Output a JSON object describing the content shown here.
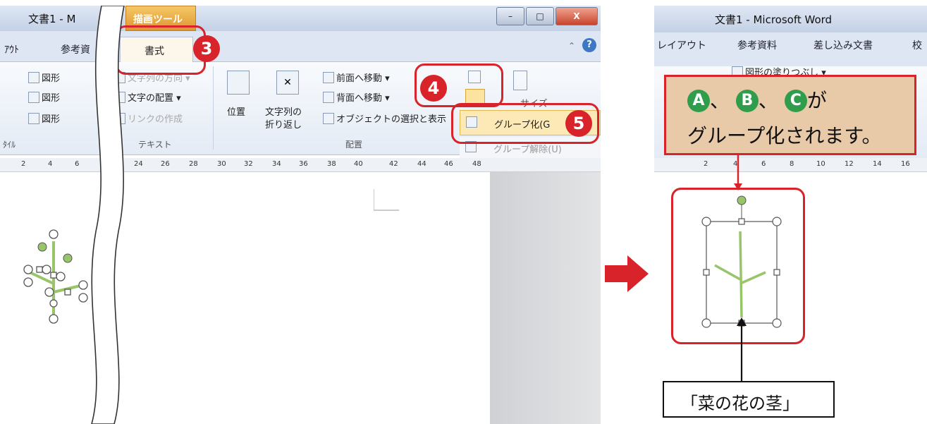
{
  "left": {
    "title": "文書1 - M",
    "tool_tab": "描画ツール",
    "window_controls": [
      "–",
      "□",
      "X"
    ],
    "tabs": [
      "ｱｳﾄ",
      "参考資"
    ],
    "active_tab": "書式",
    "help_icon": "?",
    "ribbon": {
      "shape_fill": "図形",
      "shape_outline": "図形",
      "shape_effects": "図形",
      "text_direction": "文字列の方向",
      "text_align": "文字の配置",
      "create_link": "リンクの作成",
      "text_group": "テキスト",
      "style_group": "ﾀｲﾙ",
      "position": "位置",
      "wrap_text_1": "文字列の",
      "wrap_text_2": "折り返し",
      "bring_forward": "前面へ移動",
      "send_backward": "背面へ移動",
      "selection_pane": "オブジェクトの選択と表示",
      "arrange_group": "配置",
      "size": "サイズ"
    },
    "menu": {
      "group": "グループ化(G",
      "ungroup": "グループ解除(U)"
    },
    "badges": [
      "3",
      "4",
      "5"
    ],
    "ruler_ticks": [
      "2",
      "4",
      "6",
      "24",
      "26",
      "28",
      "30",
      "32",
      "34",
      "36",
      "38",
      "40",
      "42",
      "44",
      "46",
      "48"
    ]
  },
  "right": {
    "title": "文書1 - Microsoft Word",
    "tabs": [
      "レイアウト",
      "参考資料",
      "差し込み文書",
      "校"
    ],
    "ribbon_item": "図形の塗りつぶし",
    "ruler_ticks": [
      "2",
      "4",
      "6",
      "8",
      "10",
      "12",
      "14",
      "16"
    ],
    "note": {
      "letters": [
        "A",
        "B",
        "C"
      ],
      "sep": "、",
      "ga": "が",
      "line2": "グループ化されます。"
    },
    "label": "「菜の花の茎」"
  },
  "colors": {
    "accent_red": "#d8232a",
    "letter_green": "#2f9d4c",
    "note_bg": "#e8c9a8",
    "stem_green": "#98c56a"
  }
}
